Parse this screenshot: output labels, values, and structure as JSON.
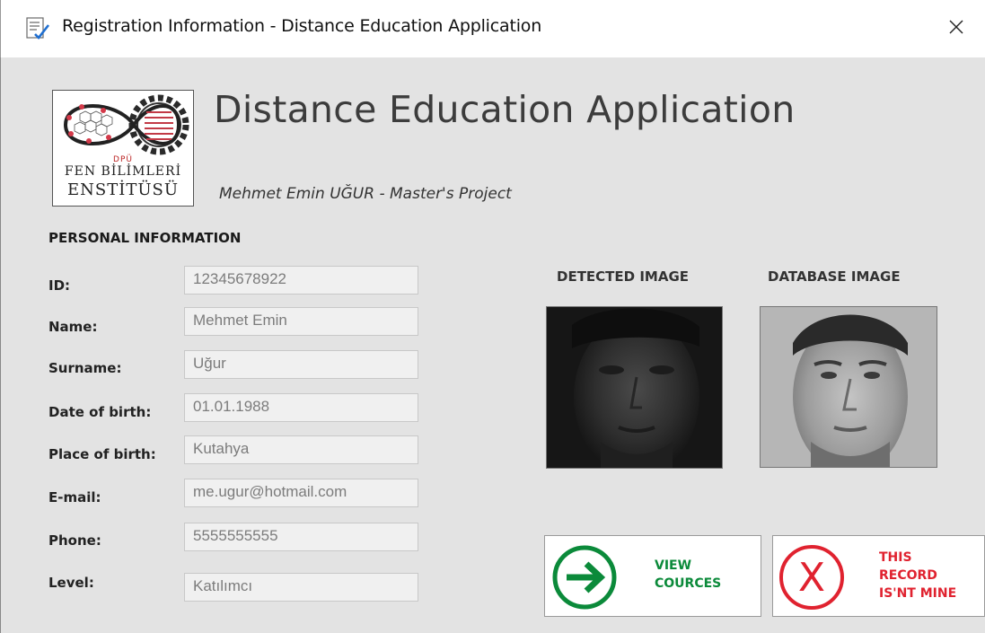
{
  "window": {
    "title": "Registration Information - Distance Education Application",
    "close_symbol": "✕"
  },
  "header": {
    "logo": {
      "dpu": "DPÜ",
      "line1": "FEN BİLİMLERİ",
      "line2": "ENSTİTÜSÜ"
    },
    "app_title": "Distance Education Application",
    "subtitle": "Mehmet Emin UĞUR - Master's Project"
  },
  "personal": {
    "section_title": "PERSONAL INFORMATION",
    "fields": [
      {
        "label": "ID:",
        "value": "12345678922"
      },
      {
        "label": "Name:",
        "value": "Mehmet Emin"
      },
      {
        "label": "Surname:",
        "value": "Uğur"
      },
      {
        "label": "Date of birth:",
        "value": "01.01.1988"
      },
      {
        "label": "Place of birth:",
        "value": "Kutahya"
      },
      {
        "label": "E-mail:",
        "value": "me.ugur@hotmail.com"
      },
      {
        "label": "Phone:",
        "value": "5555555555"
      },
      {
        "label": "Level:",
        "value": "Katılımcı"
      }
    ]
  },
  "images": {
    "detected_label": "DETECTED IMAGE",
    "database_label": "DATABASE IMAGE"
  },
  "actions": {
    "view_line1": "VIEW",
    "view_line2": "COURCES",
    "reject_line1": "THIS",
    "reject_line2": "RECORD",
    "reject_line3": "IS'NT MINE"
  },
  "colors": {
    "view_green": "#0b8a3a",
    "reject_red": "#e0222f"
  },
  "icons": {
    "title": "registration-form-icon",
    "view": "arrow-right-circle-icon",
    "reject": "x-circle-icon"
  }
}
